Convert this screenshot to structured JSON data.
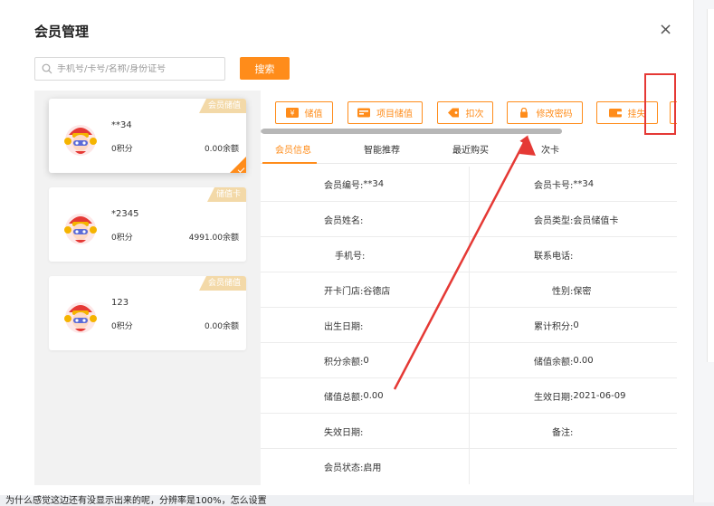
{
  "dialog": {
    "title": "会员管理",
    "close_label": "×"
  },
  "search": {
    "placeholder": "手机号/卡号/名称/身份证号",
    "button_label": "搜索"
  },
  "members": [
    {
      "tag": "会员储值",
      "name": "**34",
      "points": "0积分",
      "balance": "0.00余额",
      "selected": true
    },
    {
      "tag": "储值卡",
      "name": "*2345",
      "points": "0积分",
      "balance": "4991.00余额",
      "selected": false
    },
    {
      "tag": "会员储值",
      "name": "123",
      "points": "0积分",
      "balance": "0.00余额",
      "selected": false
    }
  ],
  "toolbar": {
    "buttons": [
      {
        "label": "储值",
        "icon": "yen-icon"
      },
      {
        "label": "项目储值",
        "icon": "card-icon"
      },
      {
        "label": "扣次",
        "icon": "tag-icon"
      },
      {
        "label": "修改密码",
        "icon": "lock-icon"
      },
      {
        "label": "挂失",
        "icon": "wallet-icon"
      }
    ]
  },
  "tabs": [
    "会员信息",
    "智能推荐",
    "最近购买",
    "次卡"
  ],
  "info_rows": [
    {
      "lk": "会员编号:",
      "lv": "**34",
      "rk": "会员卡号:",
      "rv": "**34"
    },
    {
      "lk": "会员姓名:",
      "lv": "",
      "rk": "会员类型:",
      "rv": "会员储值卡"
    },
    {
      "lk": "手机号:",
      "lv": "",
      "rk": "联系电话:",
      "rv": ""
    },
    {
      "lk": "开卡门店:",
      "lv": "谷德店",
      "rk": "性别:",
      "rv": "保密"
    },
    {
      "lk": "出生日期:",
      "lv": "",
      "rk": "累计积分:",
      "rv": "0"
    },
    {
      "lk": "积分余额:",
      "lv": "0",
      "rk": "储值余额:",
      "rv": "0.00"
    },
    {
      "lk": "储值总额:",
      "lv": "0.00",
      "rk": "生效日期:",
      "rv": "2021-06-09"
    },
    {
      "lk": "失效日期:",
      "lv": "",
      "rk": "备注:",
      "rv": ""
    },
    {
      "lk": "会员状态:",
      "lv": "启用",
      "rk": "",
      "rv": ""
    }
  ],
  "bottom_text": "为什么感觉这边还有没显示出来的呢，分辨率是100%，怎么设置",
  "colors": {
    "accent": "#ff8c1a",
    "annotation": "#e53935",
    "tag": "#f3d9a8"
  }
}
